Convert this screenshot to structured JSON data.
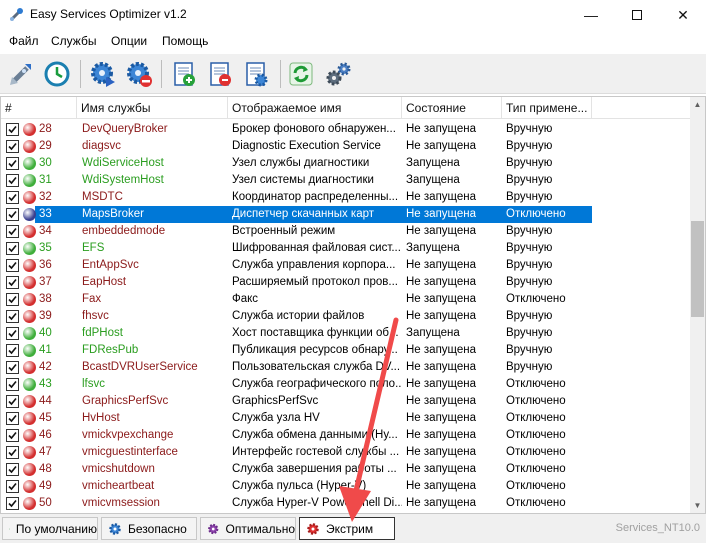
{
  "window": {
    "title": "Easy Services Optimizer v1.2"
  },
  "menu": [
    "Файл",
    "Службы",
    "Опции",
    "Помощь"
  ],
  "toolbar": {
    "buttons": [
      "rocket-icon",
      "clock-refresh-icon",
      "gear-start-icon",
      "gear-stop-icon",
      "document-add-icon",
      "document-remove-icon",
      "document-settings-icon",
      "refresh-icon",
      "gears-icon"
    ]
  },
  "columns": [
    "#",
    "Имя службы",
    "Отображаемое имя",
    "Состояние",
    "Тип примене..."
  ],
  "colors": {
    "red": "#8b1a1a",
    "green": "#2a9d1f",
    "selection": "#0078d7"
  },
  "rows": [
    {
      "num": "28",
      "name": "DevQueryBroker",
      "display": "Брокер фонового обнаружен...",
      "state": "Не запущена",
      "type": "Вручную",
      "status": "red",
      "checked": true
    },
    {
      "num": "29",
      "name": "diagsvc",
      "display": "Diagnostic Execution Service",
      "state": "Не запущена",
      "type": "Вручную",
      "status": "red",
      "checked": true
    },
    {
      "num": "30",
      "name": "WdiServiceHost",
      "display": "Узел службы диагностики",
      "state": "Запущена",
      "type": "Вручную",
      "status": "green",
      "checked": true
    },
    {
      "num": "31",
      "name": "WdiSystemHost",
      "display": "Узел системы диагностики",
      "state": "Запущена",
      "type": "Вручную",
      "status": "green",
      "checked": true
    },
    {
      "num": "32",
      "name": "MSDTC",
      "display": "Координатор распределенны...",
      "state": "Не запущена",
      "type": "Вручную",
      "status": "red",
      "checked": true
    },
    {
      "num": "33",
      "name": "MapsBroker",
      "display": "Диспетчер скачанных карт",
      "state": "Не запущена",
      "type": "Отключено",
      "status": "navy",
      "checked": true,
      "selected": true
    },
    {
      "num": "34",
      "name": "embeddedmode",
      "display": "Встроенный режим",
      "state": "Не запущена",
      "type": "Вручную",
      "status": "red",
      "checked": true
    },
    {
      "num": "35",
      "name": "EFS",
      "display": "Шифрованная файловая сист...",
      "state": "Запущена",
      "type": "Вручную",
      "status": "green",
      "checked": true
    },
    {
      "num": "36",
      "name": "EntAppSvc",
      "display": "Служба управления корпора...",
      "state": "Не запущена",
      "type": "Вручную",
      "status": "red",
      "checked": true
    },
    {
      "num": "37",
      "name": "EapHost",
      "display": "Расширяемый протокол пров...",
      "state": "Не запущена",
      "type": "Вручную",
      "status": "red",
      "checked": true
    },
    {
      "num": "38",
      "name": "Fax",
      "display": "Факс",
      "state": "Не запущена",
      "type": "Отключено",
      "status": "red",
      "checked": true
    },
    {
      "num": "39",
      "name": "fhsvc",
      "display": "Служба истории файлов",
      "state": "Не запущена",
      "type": "Вручную",
      "status": "red",
      "checked": true
    },
    {
      "num": "40",
      "name": "fdPHost",
      "display": "Хост поставщика функции об...",
      "state": "Запущена",
      "type": "Вручную",
      "status": "green",
      "checked": true
    },
    {
      "num": "41",
      "name": "FDResPub",
      "display": "Публикация ресурсов обнару...",
      "state": "Не запущена",
      "type": "Вручную",
      "status": "green",
      "checked": true
    },
    {
      "num": "42",
      "name": "BcastDVRUserService",
      "display": "Пользовательская служба DV...",
      "state": "Не запущена",
      "type": "Вручную",
      "status": "red",
      "checked": true
    },
    {
      "num": "43",
      "name": "lfsvc",
      "display": "Служба географического поло...",
      "state": "Не запущена",
      "type": "Отключено",
      "status": "green",
      "checked": true
    },
    {
      "num": "44",
      "name": "GraphicsPerfSvc",
      "display": "GraphicsPerfSvc",
      "state": "Не запущена",
      "type": "Отключено",
      "status": "red",
      "checked": true
    },
    {
      "num": "45",
      "name": "HvHost",
      "display": "Служба узла HV",
      "state": "Не запущена",
      "type": "Отключено",
      "status": "red",
      "checked": true
    },
    {
      "num": "46",
      "name": "vmickvpexchange",
      "display": "Служба обмена данными (Hy...",
      "state": "Не запущена",
      "type": "Отключено",
      "status": "red",
      "checked": true
    },
    {
      "num": "47",
      "name": "vmicguestinterface",
      "display": "Интерфейс гостевой службы ...",
      "state": "Не запущена",
      "type": "Отключено",
      "status": "red",
      "checked": true
    },
    {
      "num": "48",
      "name": "vmicshutdown",
      "display": "Служба завершения работы ...",
      "state": "Не запущена",
      "type": "Отключено",
      "status": "red",
      "checked": true
    },
    {
      "num": "49",
      "name": "vmicheartbeat",
      "display": "Служба пульса (Hyper-V)",
      "state": "Не запущена",
      "type": "Отключено",
      "status": "red",
      "checked": true
    },
    {
      "num": "50",
      "name": "vmicvmsession",
      "display": "Служба Hyper-V PowerShell Di...",
      "state": "Не запущена",
      "type": "Отключено",
      "status": "red",
      "checked": true
    }
  ],
  "presets": [
    {
      "label": "По умолчанию",
      "icon": "gear-green-icon"
    },
    {
      "label": "Безопасно",
      "icon": "gear-blue-icon"
    },
    {
      "label": "Оптимально",
      "icon": "gear-purple-icon"
    },
    {
      "label": "Экстрим",
      "icon": "gear-red-icon",
      "active": true
    }
  ],
  "status_right": "Services_NT10.0"
}
